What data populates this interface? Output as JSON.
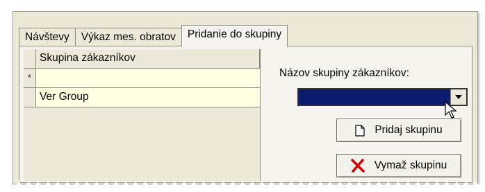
{
  "tabs": [
    {
      "label": "Návštevy"
    },
    {
      "label": "Výkaz mes. obratov"
    },
    {
      "label": "Pridanie do skupiny"
    }
  ],
  "grid": {
    "header": "Skupina zákazníkov",
    "new_row_marker": "*",
    "rows": [
      "",
      "Ver Group"
    ]
  },
  "form": {
    "group_label": "Názov skupiny zákazníkov:",
    "combo_value": "",
    "add_button": "Pridaj skupinu",
    "delete_button": "Vymaž skupinu"
  },
  "icons": {
    "add": "document-icon",
    "delete": "red-x-icon",
    "dropdown": "chevron-down-icon"
  },
  "colors": {
    "combo_selected": "#0a1c6b",
    "grid_row": "#ffffe1",
    "delete_icon": "#cc0000"
  }
}
